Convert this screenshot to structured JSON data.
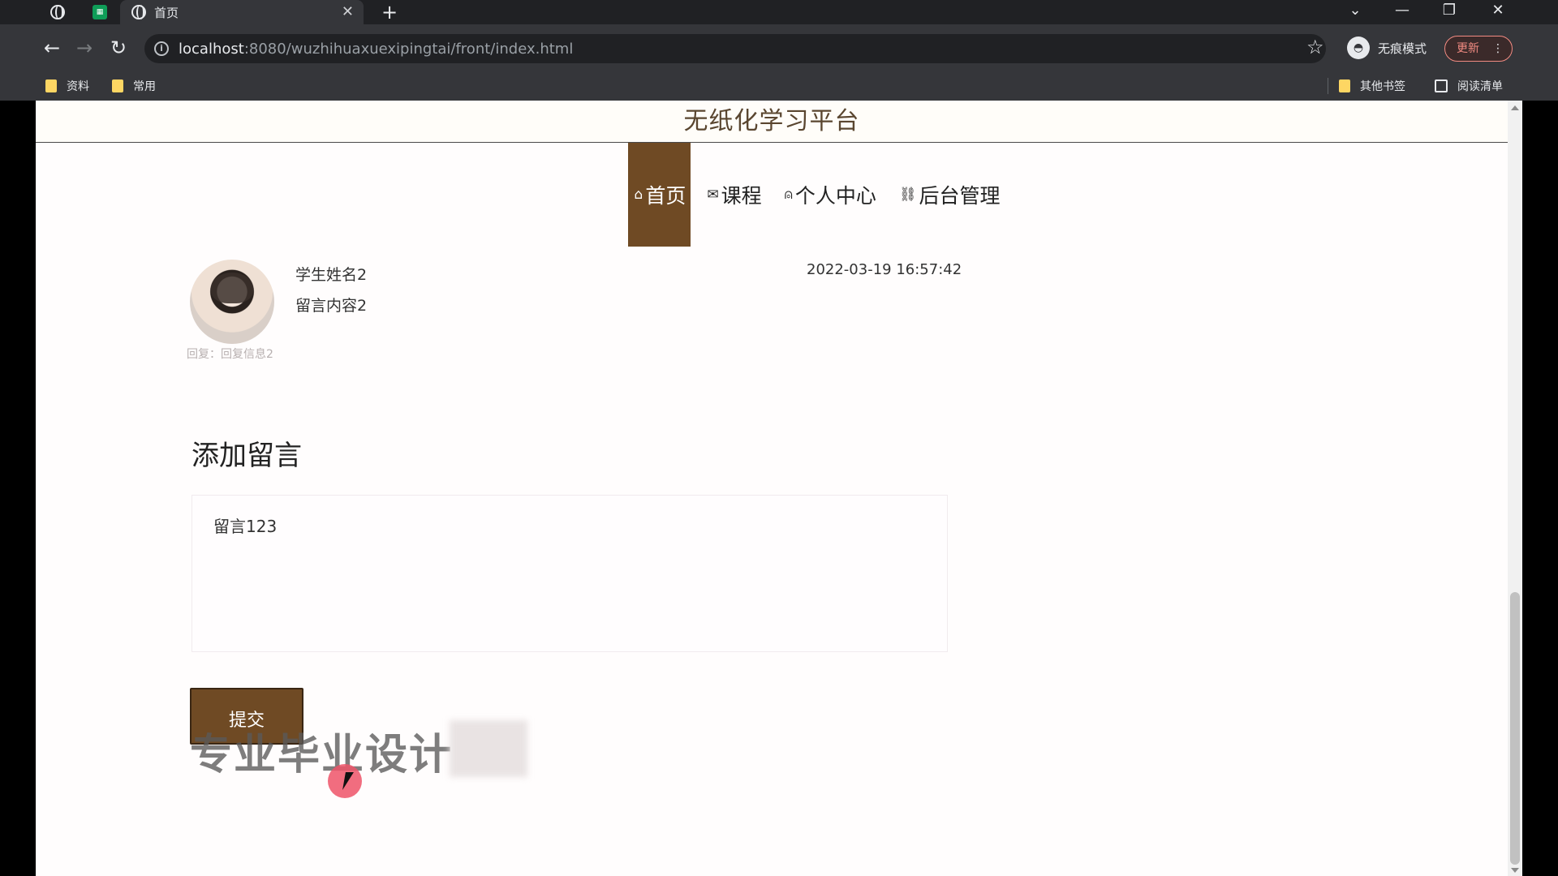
{
  "browser": {
    "tab_title": "首页",
    "tab_close": "✕",
    "new_tab": "+",
    "url_host": "localhost",
    "url_path": ":8080/wuzhihuaxuexipingtai/front/index.html",
    "incognito_label": "无痕模式",
    "update_label": "更新",
    "bookmarks": [
      "资料",
      "常用"
    ],
    "other_bookmarks": "其他书签",
    "reading_list": "阅读清单"
  },
  "site": {
    "title": "无纸化学习平台",
    "nav": [
      {
        "label": "首页",
        "icon": "home-icon"
      },
      {
        "label": "课程",
        "icon": "mail-icon"
      },
      {
        "label": "个人中心",
        "icon": "user-icon"
      },
      {
        "label": "后台管理",
        "icon": "link-icon"
      }
    ]
  },
  "message": {
    "name": "学生姓名2",
    "content": "留言内容2",
    "time": "2022-03-19 16:57:42",
    "reply": "回复：回复信息2"
  },
  "form": {
    "title": "添加留言",
    "textarea_value": "留言123",
    "submit_label": "提交"
  },
  "overlay": {
    "watermark": "专业毕业设计"
  },
  "colors": {
    "brand": "#6f4a24",
    "chrome_dark": "#202124",
    "chrome_toolbar": "#35363a"
  }
}
